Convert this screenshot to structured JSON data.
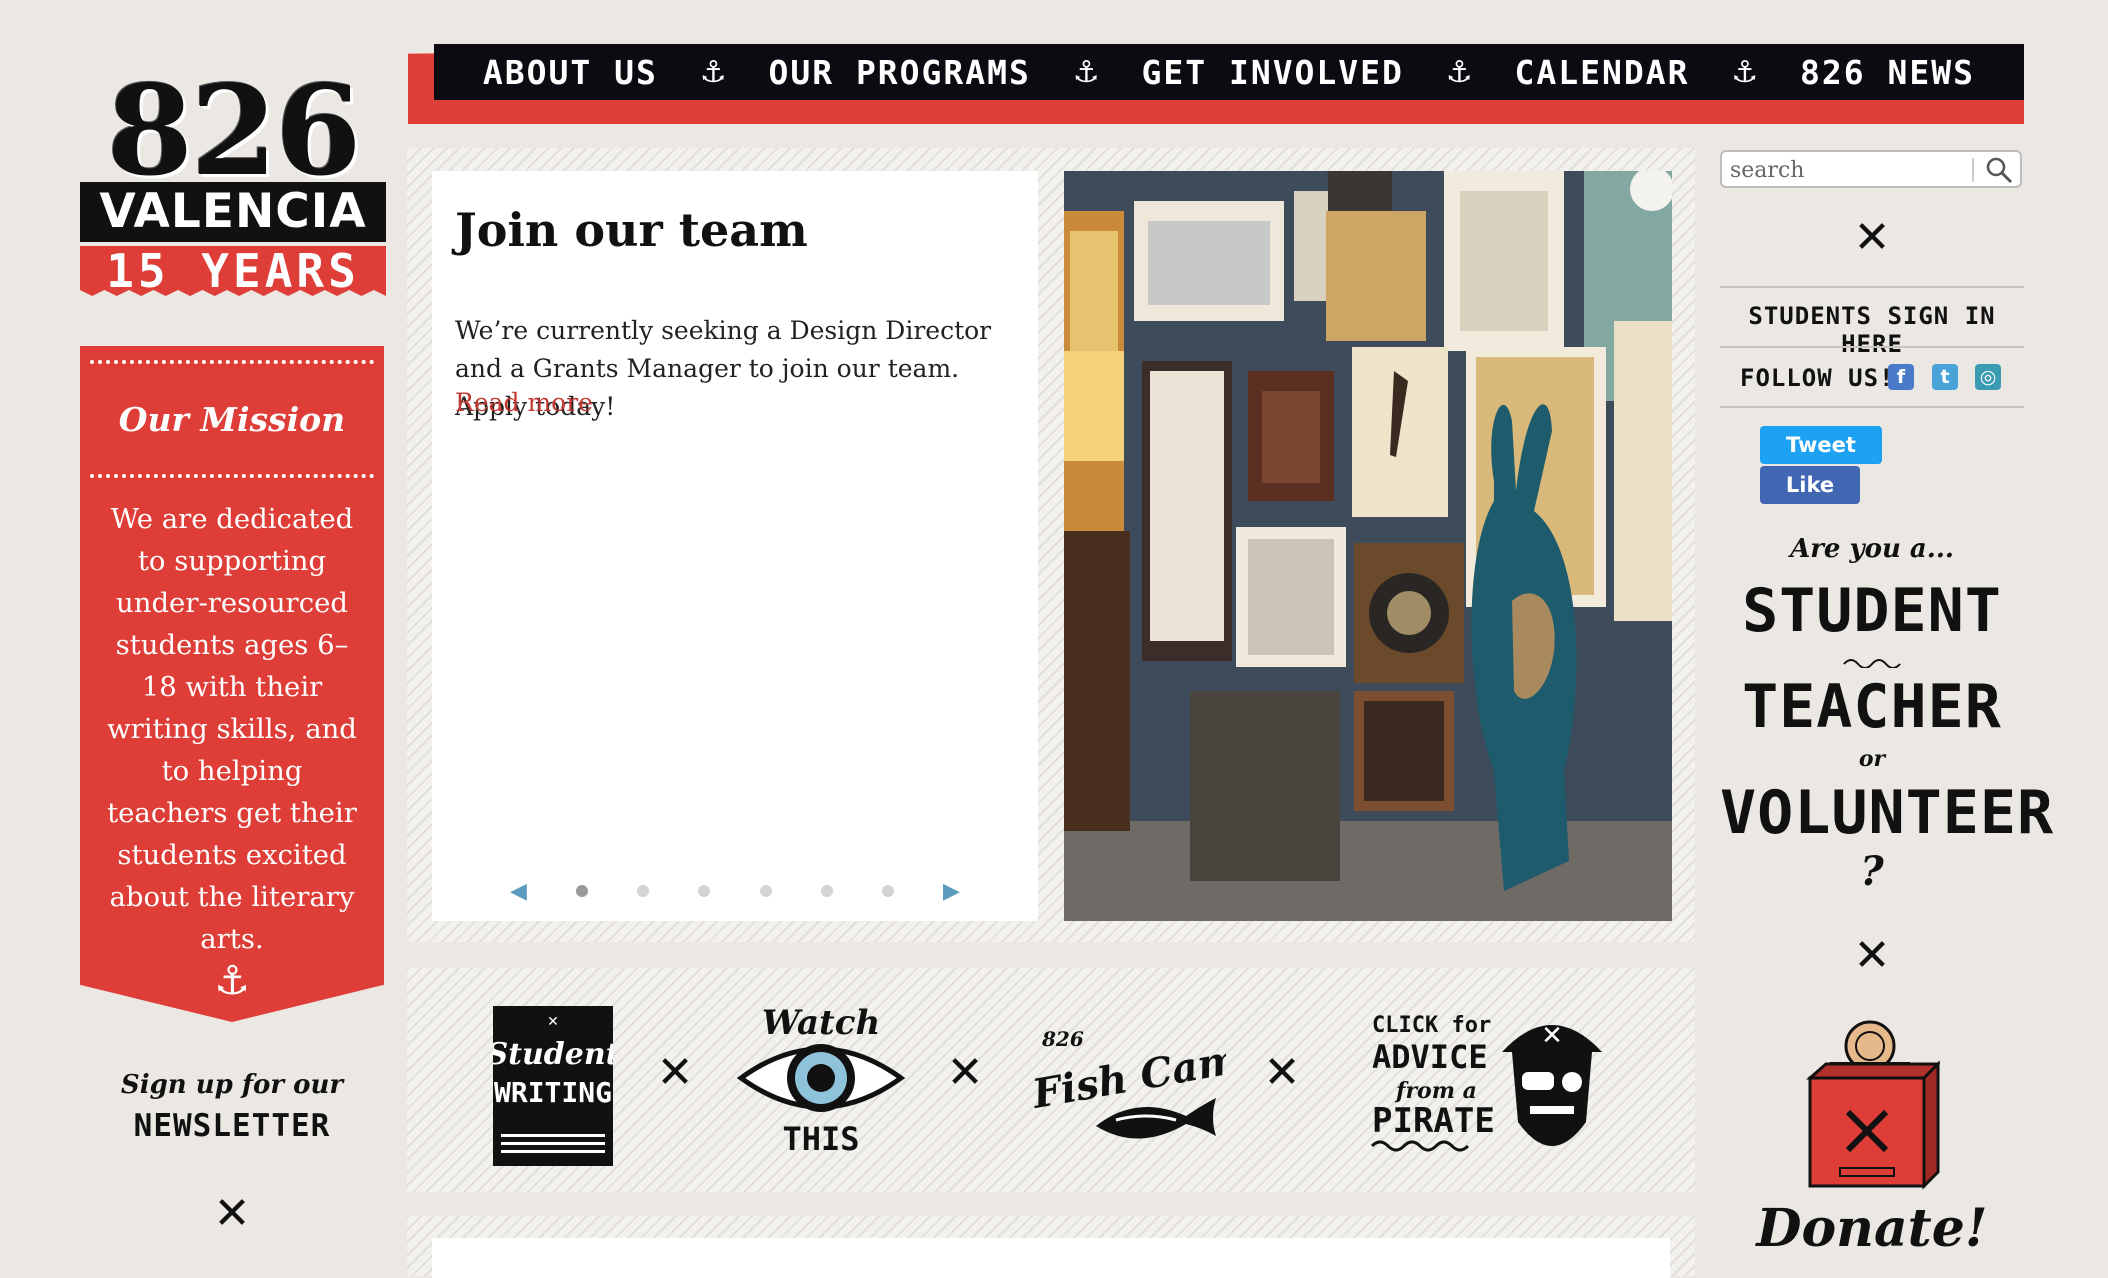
{
  "nav": {
    "items": [
      "ABOUT US",
      "OUR PROGRAMS",
      "GET INVOLVED",
      "CALENDAR",
      "826 NEWS"
    ],
    "separator": "⚓"
  },
  "logo": {
    "number": "826",
    "name": "VALENCIA",
    "years": "15 YEARS"
  },
  "mission": {
    "title": "Our Mission",
    "text": "We are dedicated to supporting under-resourced students ages 6–18 with their writing skills, and to helping teachers get their students excited about the literary arts.",
    "anchor": "⚓"
  },
  "newsletter": {
    "pre": "Sign up for our",
    "label": "NEWSLETTER"
  },
  "x_glyph": "✕",
  "hero": {
    "title": "Join our team",
    "text": "We’re currently seeking a Design Director and a Grants Manager to join our team. Apply today!",
    "link": "Read more",
    "prev": "◀",
    "next": "▶",
    "slide_count": 6,
    "active_slide": 1
  },
  "features": {
    "student_writing": {
      "line1": "Student",
      "line2": "WRITING"
    },
    "watch": {
      "line1": "Watch",
      "line2": "THIS"
    },
    "fishcam": {
      "num": "826",
      "label": "Fish Cam!"
    },
    "pirate": {
      "line1": "CLICK for",
      "line2": "ADVICE",
      "line3": "from a",
      "line4": "PIRATE"
    }
  },
  "search": {
    "placeholder": "search"
  },
  "sidebar": {
    "students_sign_in": "STUDENTS SIGN IN HERE",
    "follow": "FOLLOW US!",
    "tweet": "Tweet",
    "like": "Like",
    "are_you": "Are you a...",
    "roles": [
      "STUDENT",
      "TEACHER",
      "VOLUNTEER"
    ],
    "or": "or",
    "question": "?",
    "donate": "Donate!"
  },
  "colors": {
    "brand_red": "#de3e37",
    "nav_black": "#0d0a12",
    "background": "#ebe8e3",
    "link_red": "#c33a33",
    "slider_arrow": "#5b9bbd"
  },
  "icons": [
    "anchor-icon",
    "search-icon",
    "facebook-icon",
    "twitter-icon",
    "instagram-icon",
    "eye-icon",
    "fish-icon",
    "pirate-icon",
    "donation-box-icon",
    "close-icon"
  ]
}
